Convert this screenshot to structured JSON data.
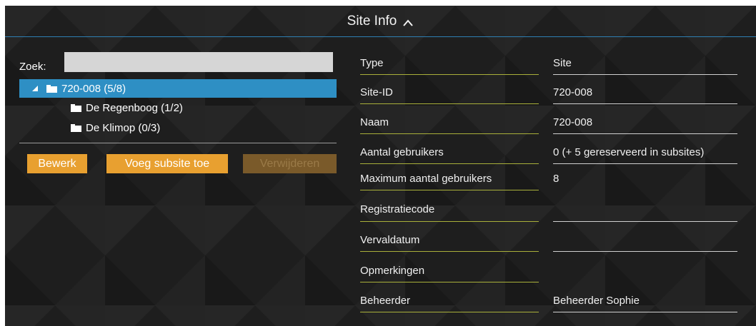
{
  "header": {
    "title": "Site Info"
  },
  "search": {
    "label": "Zoek:",
    "value": ""
  },
  "tree": {
    "root": "720-008 (5/8)",
    "children": [
      "De Regenboog (1/2)",
      "De Klimop (0/3)"
    ]
  },
  "buttons": {
    "edit": "Bewerk",
    "add_subsite": "Voeg subsite toe",
    "delete": "Verwijderen"
  },
  "info": [
    {
      "label": "Type",
      "value": "Site"
    },
    {
      "label": "Site-ID",
      "value": "720-008"
    },
    {
      "label": "Naam",
      "value": "720-008"
    },
    {
      "label": "Aantal gebruikers",
      "value": "0 (+ 5 gereserveerd in subsites)"
    },
    {
      "label": "Maximum aantal gebruikers",
      "value": "8"
    },
    {
      "label": "Registratiecode",
      "value": ""
    },
    {
      "label": "Vervaldatum",
      "value": ""
    },
    {
      "label": "Opmerkingen",
      "value": ""
    },
    {
      "label": "Beheerder",
      "value": "Beheerder Sophie"
    }
  ],
  "colors": {
    "accent": "#2e8fc4",
    "button": "#e8a030",
    "label_underline": "#a9b03a",
    "panel_bg": "#1e1e1e"
  },
  "icons": [
    "chevron-up-icon",
    "expand-triangle-icon",
    "folder-icon"
  ]
}
